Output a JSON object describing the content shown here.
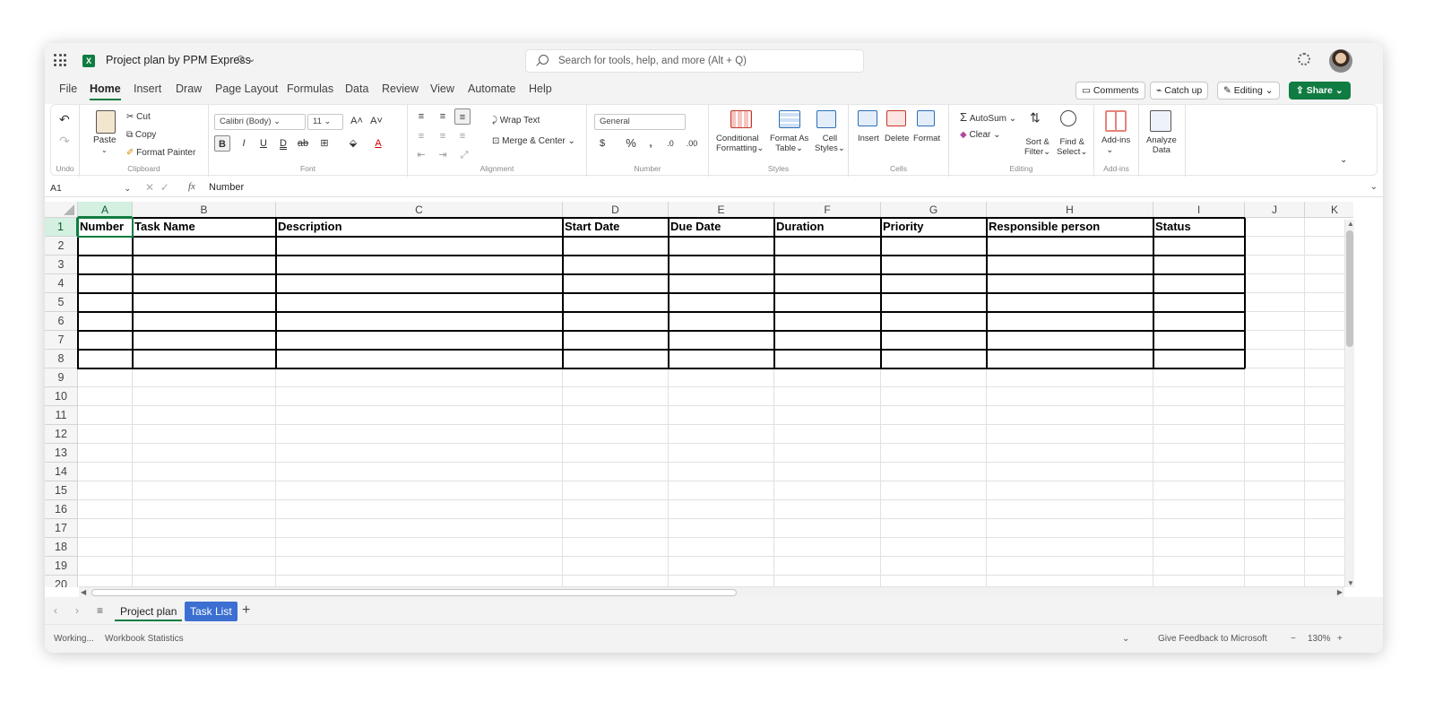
{
  "title_bar": {
    "doc_title": "Project plan by PPM Express",
    "doc_extra": "⊙ ⌄",
    "search_placeholder": "Search for tools, help, and more (Alt + Q)"
  },
  "menu": {
    "items": [
      "File",
      "Home",
      "Insert",
      "Draw",
      "Page Layout",
      "Formulas",
      "Data",
      "Review",
      "View",
      "Automate",
      "Help"
    ],
    "active": "Home",
    "comments": "Comments",
    "catch_up": "Catch up",
    "editing": "Editing",
    "share": "Share"
  },
  "ribbon": {
    "undo_label": "Undo",
    "paste": "Paste",
    "cut": "Cut",
    "copy": "Copy",
    "format_painter": "Format Painter",
    "clipboard_label": "Clipboard",
    "font_name": "Calibri (Body)",
    "font_size": "11",
    "font_label": "Font",
    "wrap_text": "Wrap Text",
    "merge_center": "Merge & Center",
    "alignment_label": "Alignment",
    "number_format": "General",
    "number_label": "Number",
    "conditional_formatting_1": "Conditional",
    "conditional_formatting_2": "Formatting",
    "format_as_table_1": "Format As",
    "format_as_table_2": "Table",
    "cell_styles_1": "Cell",
    "cell_styles_2": "Styles",
    "styles_label": "Styles",
    "insert": "Insert",
    "delete": "Delete",
    "format": "Format",
    "cells_label": "Cells",
    "autosum": "AutoSum",
    "clear": "Clear",
    "sort_filter_1": "Sort &",
    "sort_filter_2": "Filter",
    "find_select_1": "Find &",
    "find_select_2": "Select",
    "editing_label": "Editing",
    "addins": "Add-ins",
    "addins_label": "Add-ins",
    "analyze_1": "Analyze",
    "analyze_2": "Data"
  },
  "formula_bar": {
    "name_box": "A1",
    "value": "Number"
  },
  "grid": {
    "columns": [
      "A",
      "B",
      "C",
      "D",
      "E",
      "F",
      "G",
      "H",
      "I",
      "J",
      "K"
    ],
    "rows": [
      "1",
      "2",
      "3",
      "4",
      "5",
      "6",
      "7",
      "8",
      "9",
      "10",
      "11",
      "12",
      "13",
      "14",
      "15",
      "16",
      "17",
      "18",
      "19",
      "20"
    ],
    "header_row": [
      "Number",
      "Task Name",
      "Description",
      "Start Date",
      "Due Date",
      "Duration",
      "Priority",
      "Responsible person",
      "Status"
    ],
    "selected_cell": "A1"
  },
  "sheets": {
    "tabs": [
      "Project plan",
      "Task List"
    ],
    "active": "Project plan"
  },
  "status_bar": {
    "working": "Working...",
    "workbook_statistics": "Workbook Statistics",
    "feedback": "Give Feedback to Microsoft",
    "zoom": "130%"
  }
}
